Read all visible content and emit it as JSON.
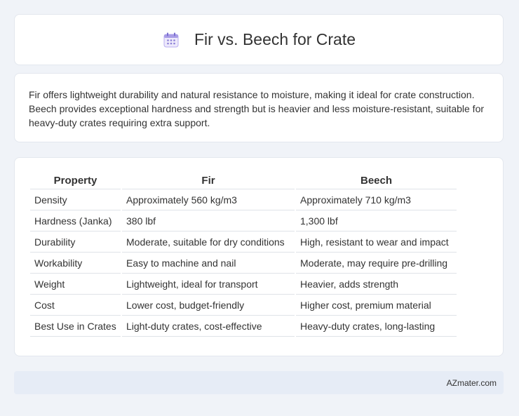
{
  "header": {
    "title": "Fir vs. Beech for Crate",
    "icon": "calendar-icon"
  },
  "description": "Fir offers lightweight durability and natural resistance to moisture, making it ideal for crate construction. Beech provides exceptional hardness and strength but is heavier and less moisture-resistant, suitable for heavy-duty crates requiring extra support.",
  "table": {
    "headers": [
      "Property",
      "Fir",
      "Beech"
    ],
    "rows": [
      [
        "Density",
        "Approximately 560 kg/m3",
        "Approximately 710 kg/m3"
      ],
      [
        "Hardness (Janka)",
        "380 lbf",
        "1,300 lbf"
      ],
      [
        "Durability",
        "Moderate, suitable for dry conditions",
        "High, resistant to wear and impact"
      ],
      [
        "Workability",
        "Easy to machine and nail",
        "Moderate, may require pre-drilling"
      ],
      [
        "Weight",
        "Lightweight, ideal for transport",
        "Heavier, adds strength"
      ],
      [
        "Cost",
        "Lower cost, budget-friendly",
        "Higher cost, premium material"
      ],
      [
        "Best Use in Crates",
        "Light-duty crates, cost-effective",
        "Heavy-duty crates, long-lasting"
      ]
    ]
  },
  "footer": {
    "site": "AZmater.com"
  },
  "colors": {
    "background": "#f0f3f8",
    "card": "#ffffff",
    "footer": "#e6ecf6",
    "icon_accent": "#8b7fd6"
  }
}
